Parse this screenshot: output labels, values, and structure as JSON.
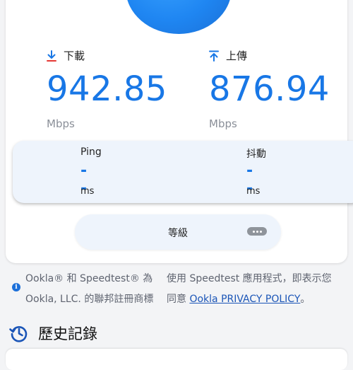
{
  "download": {
    "label": "下載",
    "value": "942.85",
    "unit": "Mbps",
    "icon": "download-arrow-icon"
  },
  "upload": {
    "label": "上傳",
    "value": "876.94",
    "unit": "Mbps",
    "icon": "upload-arrow-icon"
  },
  "latency": {
    "ping": {
      "label": "Ping",
      "value": "--",
      "unit": "ms"
    },
    "jitter": {
      "label": "抖動",
      "value": "--",
      "unit": "ms"
    }
  },
  "grade": {
    "label": "等級",
    "icon": "more-icon"
  },
  "legal": {
    "left_line1": "Ookla® 和 Speedtest® 為",
    "left_line2": "Ookla, LLC. 的聯邦註冊商標",
    "right_line1": "使用 Speedtest 應用程式，即表示您",
    "right_prefix": "同意",
    "right_link": "Ookla PRIVACY POLICY",
    "right_suffix": "。"
  },
  "history": {
    "title": "歷史記錄",
    "icon": "history-icon"
  },
  "colors": {
    "accent": "#1877e6",
    "download_arrow": "#1877e6",
    "upload_arrow": "#1877e6",
    "link": "#1b55b7"
  }
}
